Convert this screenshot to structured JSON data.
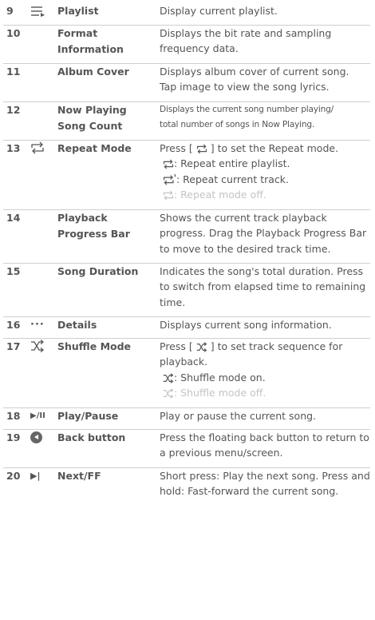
{
  "rows": [
    {
      "num": "9",
      "icon": "playlist-icon",
      "term": "Playlist",
      "desc": [
        "Display current playlist."
      ]
    },
    {
      "num": "10",
      "icon": "",
      "term": "Format Information",
      "desc": [
        "Displays the bit rate and sampling frequency data."
      ]
    },
    {
      "num": "11",
      "icon": "",
      "term": "Album Cover",
      "desc": [
        "Displays album cover of current song.",
        "Tap image to view the song lyrics."
      ]
    },
    {
      "num": "12",
      "icon": "",
      "term": "Now Playing Song Count",
      "desc": [
        "Displays the current song number playing/",
        "total number of songs in Now Playing."
      ]
    },
    {
      "num": "13",
      "icon": "repeat-icon",
      "term": "Repeat Mode",
      "desc_intro_a": "Press [",
      "desc_intro_b": "] to set the Repeat mode.",
      "options": [
        {
          "label": ": Repeat entire playlist."
        },
        {
          "label": ": Repeat current track."
        },
        {
          "label": ": Repeat mode off."
        }
      ]
    },
    {
      "num": "14",
      "icon": "",
      "term": "Playback Progress Bar",
      "desc": [
        "Shows the current track playback progress. Drag the Playback Progress Bar to move to the desired track time."
      ]
    },
    {
      "num": "15",
      "icon": "",
      "term": "Song Duration",
      "desc": [
        "Indicates the song's total duration. Press to switch from elapsed time to remaining time."
      ]
    },
    {
      "num": "16",
      "icon": "details-icon",
      "term": "Details",
      "icon_text": "···",
      "desc": [
        "Displays current song information."
      ]
    },
    {
      "num": "17",
      "icon": "shuffle-icon",
      "term": "Shuffle Mode",
      "desc_intro_a": "Press [",
      "desc_intro_b": "] to set track sequence for playback.",
      "options": [
        {
          "label": ": Shuffle mode on."
        },
        {
          "label": ": Shuffle mode off."
        }
      ]
    },
    {
      "num": "18",
      "icon": "play-pause-icon",
      "term": "Play/Pause",
      "icon_text": "▶/II",
      "desc": [
        "Play or pause the current song."
      ]
    },
    {
      "num": "19",
      "icon": "back-icon",
      "term": "Back button",
      "desc": [
        "Press the floating back button to return to a previous menu/screen."
      ]
    },
    {
      "num": "20",
      "icon": "next-ff-icon",
      "term": "Next/FF",
      "icon_text": "▶|",
      "desc": [
        "Short press: Play the next song. Press and hold: Fast-forward the current song."
      ]
    }
  ],
  "colors": {
    "text": "#555555",
    "rule": "#cfcfcf",
    "faded": "#c4c4c4"
  }
}
